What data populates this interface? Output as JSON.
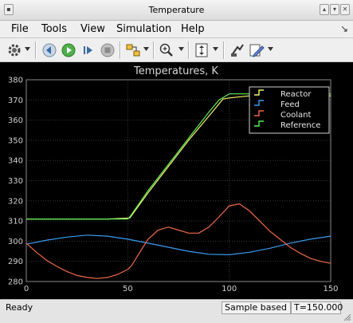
{
  "window": {
    "title": "Temperature"
  },
  "menu": {
    "file": "File",
    "tools": "Tools",
    "view": "View",
    "simulation": "Simulation",
    "help": "Help"
  },
  "toolbar_icons": [
    "gear-icon",
    "step-back-icon",
    "run-icon",
    "step-forward-icon",
    "stop-icon",
    "highlight-block-icon",
    "zoom-in-icon",
    "autoscale-icon",
    "restore-icon",
    "edit-icon"
  ],
  "status": {
    "ready": "Ready",
    "mode": "Sample based",
    "time": "T=150.000"
  },
  "colors": {
    "reactor": "#f6f66a",
    "feed": "#3c9bf0",
    "coolant": "#f06a48",
    "reference": "#5ff05a"
  },
  "chart_data": {
    "type": "line",
    "title": "Temperatures, K",
    "xlim": [
      0,
      150
    ],
    "ylim": [
      280,
      380
    ],
    "xticks": [
      0,
      50,
      100,
      150
    ],
    "yticks": [
      280,
      290,
      300,
      310,
      320,
      330,
      340,
      350,
      360,
      370,
      380
    ],
    "grid": true,
    "legend_position": "top-right",
    "series": [
      {
        "name": "Reactor",
        "color": "#f6f66a",
        "x": [
          0,
          20,
          40,
          51,
          60,
          70,
          80,
          90,
          97,
          100,
          110,
          120,
          130,
          140,
          150
        ],
        "y": [
          311,
          311,
          311,
          311.5,
          324,
          337,
          350,
          362,
          370.5,
          371,
          372,
          372,
          372,
          372,
          372
        ]
      },
      {
        "name": "Feed",
        "color": "#3c9bf0",
        "x": [
          0,
          10,
          20,
          30,
          40,
          50,
          60,
          70,
          80,
          90,
          100,
          110,
          120,
          130,
          140,
          150
        ],
        "y": [
          298.5,
          300.5,
          302,
          303,
          302.5,
          301,
          299,
          297,
          295,
          293.5,
          293.3,
          294.5,
          296.5,
          299,
          301,
          302.5
        ]
      },
      {
        "name": "Coolant",
        "color": "#f06a48",
        "x": [
          0,
          5,
          10,
          15,
          20,
          25,
          30,
          35,
          40,
          45,
          50,
          52,
          55,
          60,
          65,
          70,
          75,
          80,
          85,
          90,
          95,
          100,
          105,
          110,
          115,
          120,
          125,
          130,
          135,
          140,
          145,
          150
        ],
        "y": [
          299,
          294.5,
          290.5,
          287.5,
          285,
          283,
          282,
          281.5,
          282,
          283.5,
          286,
          288,
          293,
          301,
          305.5,
          307,
          305.5,
          304,
          304,
          307,
          312,
          317.5,
          318.5,
          315,
          310,
          305,
          301,
          297,
          294,
          291.5,
          290,
          289
        ]
      },
      {
        "name": "Reference",
        "color": "#5ff05a",
        "x": [
          0,
          50,
          51,
          60,
          70,
          80,
          90,
          95,
          100,
          110,
          120,
          130,
          140,
          150
        ],
        "y": [
          311,
          311,
          312,
          325,
          338,
          351,
          364,
          370,
          373,
          373,
          373,
          373,
          373,
          373
        ]
      }
    ]
  }
}
